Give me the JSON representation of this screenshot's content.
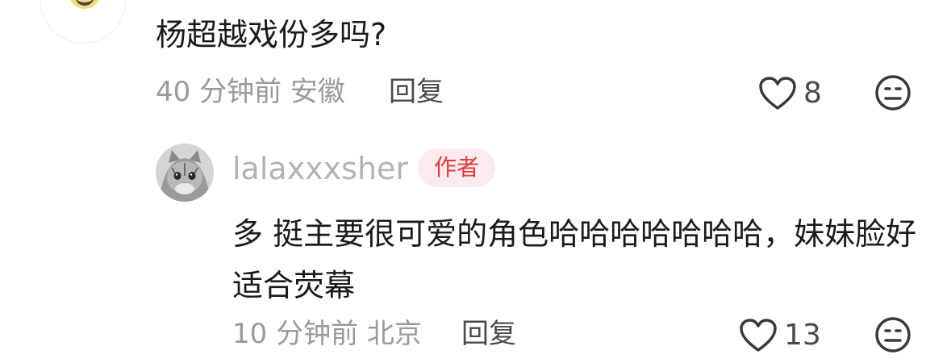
{
  "comment": {
    "text": "杨超越戏份多吗?",
    "time": "40 分钟前",
    "location": "安徽",
    "reply_label": "回复",
    "likes": "8"
  },
  "reply": {
    "username": "lalaxxxsher",
    "badge": "作者",
    "text": "多 挺主要很可爱的角色哈哈哈哈哈哈哈，妹妹脸好适合荧幕",
    "time": "10 分钟前",
    "location": "北京",
    "reply_label": "回复",
    "likes": "13"
  },
  "icons": {
    "like": "heart-outline-icon",
    "dislike": "unhappy-face-icon",
    "avatar": "cat-avatar"
  },
  "colors": {
    "badge_text": "#e4393c",
    "badge_bg": "#fdecef",
    "meta": "#9a9a9a",
    "text": "#1a1a1a"
  }
}
